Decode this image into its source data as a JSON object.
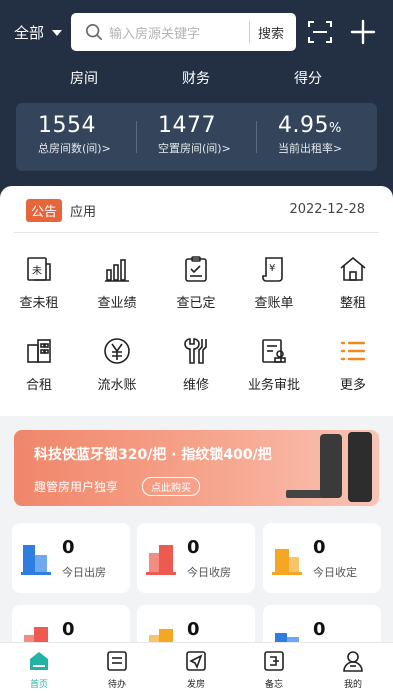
{
  "header": {
    "scope_label": "全部",
    "search_placeholder": "输入房源关键字",
    "search_button": "搜索"
  },
  "tabs": [
    {
      "label": "房间",
      "active": true
    },
    {
      "label": "财务",
      "active": false
    },
    {
      "label": "得分",
      "active": false
    }
  ],
  "stats": [
    {
      "value": "1554",
      "unit": "",
      "label": "总房间数(间)>"
    },
    {
      "value": "1477",
      "unit": "",
      "label": "空置房间(间)>"
    },
    {
      "value": "4.95",
      "unit": "%",
      "label": "当前出租率>"
    }
  ],
  "notice": {
    "badge": "公告",
    "text": "应用",
    "date": "2022-12-28"
  },
  "grid": [
    {
      "label": "查未租",
      "icon": "unrented-doc-icon"
    },
    {
      "label": "查业绩",
      "icon": "bar-chart-icon"
    },
    {
      "label": "查已定",
      "icon": "clipboard-check-icon"
    },
    {
      "label": "查账单",
      "icon": "bill-scroll-icon"
    },
    {
      "label": "整租",
      "icon": "house-icon"
    },
    {
      "label": "合租",
      "icon": "building-icon"
    },
    {
      "label": "流水账",
      "icon": "yen-circle-icon"
    },
    {
      "label": "维修",
      "icon": "wrench-icon"
    },
    {
      "label": "业务审批",
      "icon": "approval-stamp-icon"
    },
    {
      "label": "更多",
      "icon": "list-more-icon"
    }
  ],
  "banner": {
    "title": "科技侠蓝牙锁320/把 · 指纹锁400/把",
    "subtitle": "趣管房用户独享",
    "button": "点此购买"
  },
  "tiles": [
    {
      "value": "0",
      "label": "今日出房",
      "color": "#2f7de1"
    },
    {
      "value": "0",
      "label": "今日收房",
      "color": "#ee5a4f"
    },
    {
      "value": "0",
      "label": "今日收定",
      "color": "#f5a623"
    },
    {
      "value": "0",
      "label": "",
      "color": "#ee5a4f"
    },
    {
      "value": "0",
      "label": "",
      "color": "#f5a623"
    },
    {
      "value": "0",
      "label": "",
      "color": "#2f7de1"
    }
  ],
  "nav": [
    {
      "label": "首页",
      "active": true
    },
    {
      "label": "待办",
      "active": false
    },
    {
      "label": "发房",
      "active": false
    },
    {
      "label": "备忘",
      "active": false
    },
    {
      "label": "我的",
      "active": false
    }
  ],
  "colors": {
    "header_bg": "#233044",
    "accent": "#23b3a5",
    "notice_badge": "#e8653c"
  }
}
